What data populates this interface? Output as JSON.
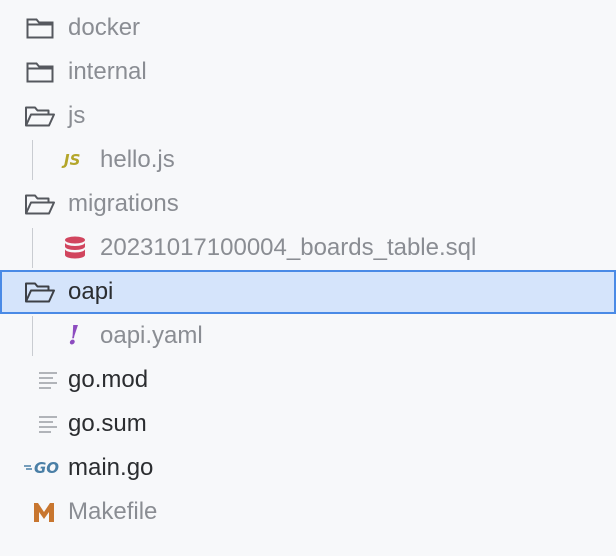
{
  "tree": {
    "items": [
      {
        "label": "docker",
        "icon": "folder-icon"
      },
      {
        "label": "internal",
        "icon": "folder-icon"
      },
      {
        "label": "js",
        "icon": "folder-open-icon"
      },
      {
        "label": "hello.js",
        "icon": "javascript-file-icon",
        "badge": "JS"
      },
      {
        "label": "migrations",
        "icon": "folder-open-icon"
      },
      {
        "label": "20231017100004_boards_table.sql",
        "icon": "database-icon"
      },
      {
        "label": "oapi",
        "icon": "folder-open-icon"
      },
      {
        "label": "oapi.yaml",
        "icon": "yaml-file-icon",
        "badge": "!"
      },
      {
        "label": "go.mod",
        "icon": "text-file-icon"
      },
      {
        "label": "go.sum",
        "icon": "text-file-icon"
      },
      {
        "label": "main.go",
        "icon": "go-file-icon",
        "badge": "GO"
      },
      {
        "label": "Makefile",
        "icon": "makefile-icon"
      }
    ]
  },
  "colors": {
    "selection_bg": "#d5e4fb",
    "selection_border": "#4a8ae6",
    "js": "#b4a62a",
    "sql": "#d1455e",
    "yaml": "#8d4cc0",
    "go": "#4a7fa6",
    "makefile": "#c8762f"
  }
}
